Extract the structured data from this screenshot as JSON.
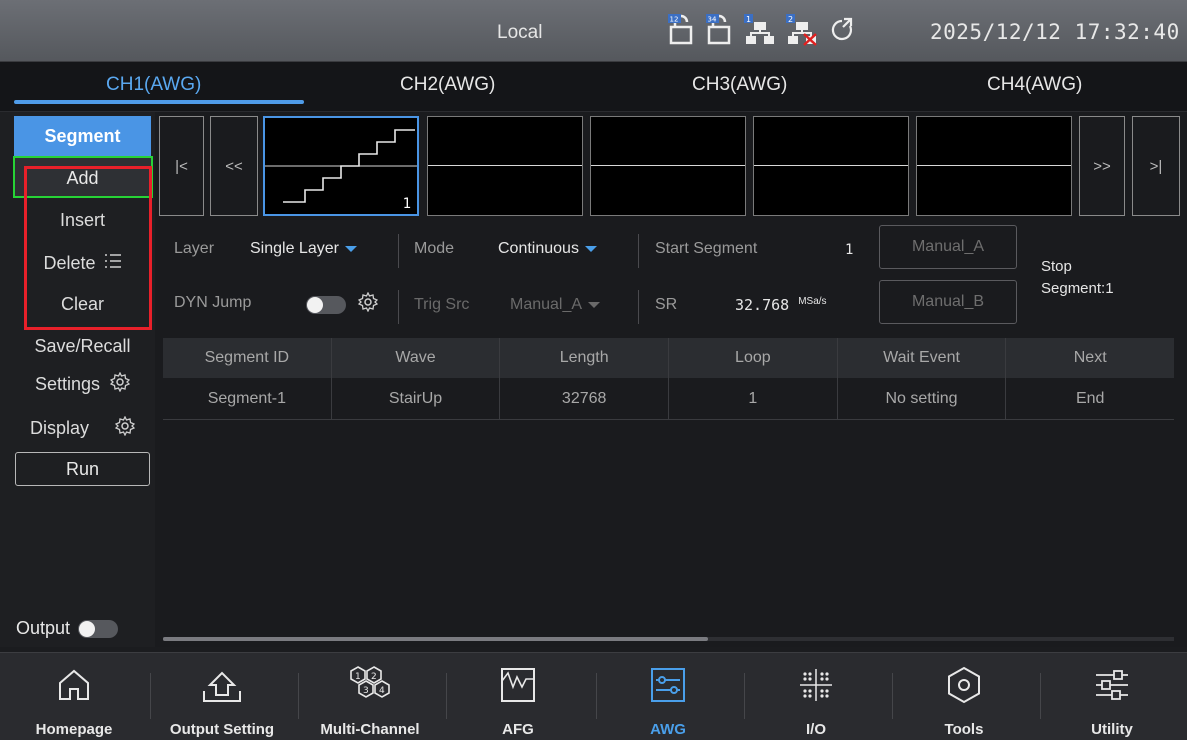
{
  "status": {
    "mode": "Local",
    "icons": [
      "lock-ch12-icon",
      "lock-ch34-icon",
      "network-1-icon",
      "network-2-disconnected-icon",
      "refresh-icon"
    ],
    "datetime": "2025/12/12 17:32:40"
  },
  "tabs": [
    {
      "label": "CH1(AWG)",
      "active": true
    },
    {
      "label": "CH2(AWG)"
    },
    {
      "label": "CH3(AWG)"
    },
    {
      "label": "CH4(AWG)"
    }
  ],
  "menu": {
    "segment": "Segment",
    "add": "Add",
    "insert": "Insert",
    "delete": "Delete",
    "clear": "Clear",
    "save_recall": "Save/Recall",
    "settings": "Settings",
    "display": "Display",
    "run": "Run",
    "output": "Output"
  },
  "segments_strip": {
    "first": "|<",
    "prev": "<<",
    "next": ">>",
    "last": ">|",
    "selected_number": "1"
  },
  "params": {
    "layer_label": "Layer",
    "layer_value": "Single Layer",
    "mode_label": "Mode",
    "mode_value": "Continuous",
    "start_segment_label": "Start Segment",
    "start_segment_value": "1",
    "manual_a": "Manual_A",
    "manual_b": "Manual_B",
    "dyn_jump_label": "DYN Jump",
    "trig_src_label": "Trig Src",
    "trig_src_value": "Manual_A",
    "sr_label": "SR",
    "sr_value": "32.768",
    "sr_unit": "MSa/s",
    "stop_line1": "Stop",
    "stop_line2": "Segment:1"
  },
  "table": {
    "headers": [
      "Segment ID",
      "Wave",
      "Length",
      "Loop",
      "Wait Event",
      "Next"
    ],
    "rows": [
      [
        "Segment-1",
        "StairUp",
        "32768",
        "1",
        "No setting",
        "End"
      ]
    ]
  },
  "bottom_nav": [
    {
      "label": "Homepage"
    },
    {
      "label": "Output Setting"
    },
    {
      "label": "Multi-Channel"
    },
    {
      "label": "AFG"
    },
    {
      "label": "AWG",
      "active": true
    },
    {
      "label": "I/O"
    },
    {
      "label": "Tools"
    },
    {
      "label": "Utility"
    }
  ],
  "colors": {
    "accent": "#4a95e5",
    "highlight_green": "#27d336",
    "highlight_red": "#e8202a"
  }
}
